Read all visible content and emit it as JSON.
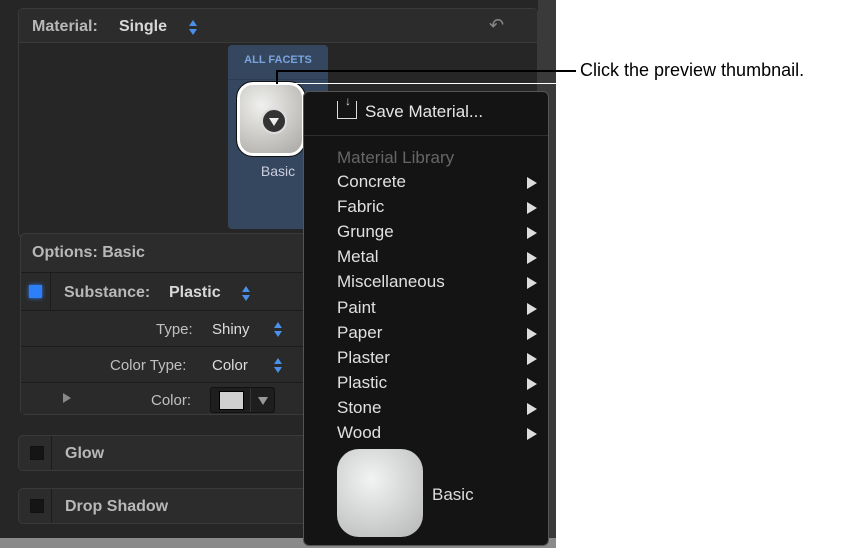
{
  "material": {
    "label": "Material:",
    "value": "Single"
  },
  "preview": {
    "facets_label": "ALL FACETS",
    "name": "Basic"
  },
  "options": {
    "title": "Options: Basic",
    "substance_label": "Substance:",
    "substance_value": "Plastic",
    "type_label": "Type:",
    "type_value": "Shiny",
    "color_type_label": "Color Type:",
    "color_type_value": "Color",
    "color_label": "Color:",
    "swatch_color": "#d0d0d0"
  },
  "glow": {
    "label": "Glow"
  },
  "drop_shadow": {
    "label": "Drop Shadow"
  },
  "menu": {
    "save": "Save Material...",
    "library_header": "Material Library",
    "items": [
      "Concrete",
      "Fabric",
      "Grunge",
      "Metal",
      "Miscellaneous",
      "Paint",
      "Paper",
      "Plaster",
      "Plastic",
      "Stone",
      "Wood"
    ],
    "recent_name": "Basic"
  },
  "callout": "Click the preview thumbnail.",
  "colors": {
    "accent": "#4a8fe8",
    "card": "#34475f"
  }
}
